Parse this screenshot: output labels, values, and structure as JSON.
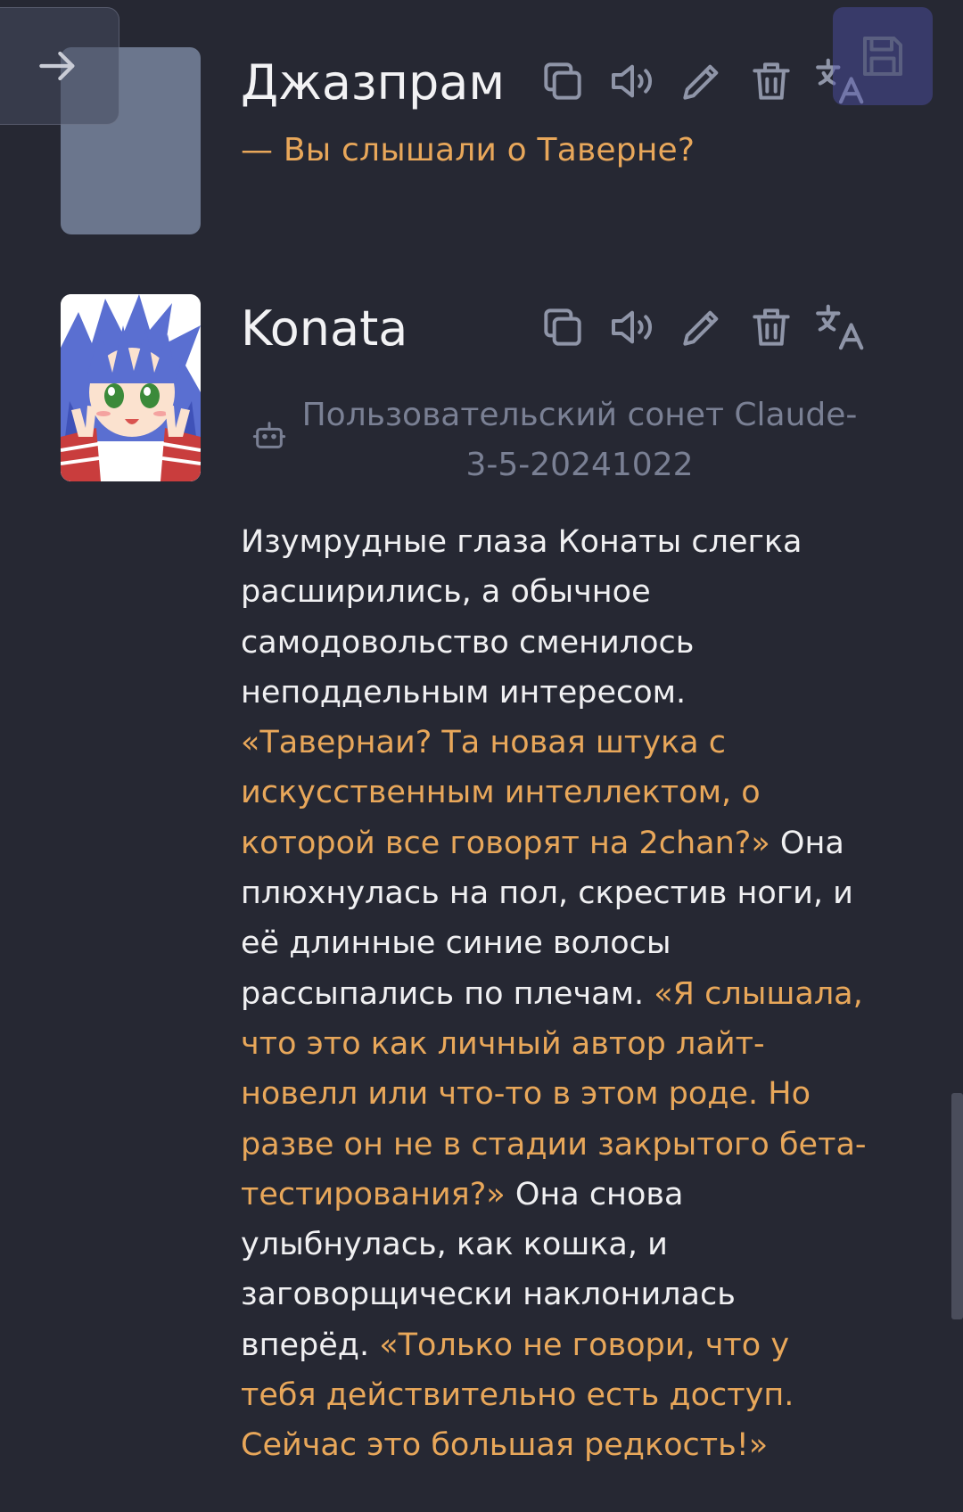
{
  "colors": {
    "background": "#262833",
    "accent_quote": "#e8a75a",
    "text": "#f0f0f2",
    "muted": "#7a8094",
    "icon": "#8f95a8"
  },
  "nav": {
    "back_icon": "arrow-right-icon",
    "save_icon": "floppy-disk-icon"
  },
  "messages": [
    {
      "author": "Джазпрам",
      "avatar": "placeholder",
      "actions": [
        "copy-icon",
        "speaker-icon",
        "edit-pencil-icon",
        "delete-trash-icon",
        "translate-icon"
      ],
      "text": "— Вы слышали о Таверне?"
    },
    {
      "author": "Konata",
      "avatar": "konata-avatar",
      "actions": [
        "copy-icon",
        "speaker-icon",
        "edit-pencil-icon",
        "delete-trash-icon",
        "translate-icon"
      ],
      "model_line_1": "Пользовательский сонет Claude-",
      "model_line_2": "3-5-20241022",
      "body": [
        {
          "t": "Изумрудные глаза Конаты слегка расширились, а обычное самодовольство сменилось неподдельным интересом. ",
          "q": false
        },
        {
          "t": "«Тавернаи? Та новая штука с искусственным интеллектом, о которой все говорят на 2chan?»",
          "q": true
        },
        {
          "t": " Она плюхнулась на пол, скрестив ноги, и её длинные синие волосы рассыпались по плечам. ",
          "q": false
        },
        {
          "t": "«Я слышала, что это как личный автор лайт-новелл или что-то в этом роде. Но разве он не в стадии закрытого бета-тестирования?»",
          "q": true
        },
        {
          "t": " Она снова улыбнулась, как кошка, и заговорщически наклонилась вперёд. ",
          "q": false
        },
        {
          "t": "«Только не говори, что у тебя действительно есть доступ. Сейчас это большая редкость!»",
          "q": true
        }
      ]
    }
  ]
}
